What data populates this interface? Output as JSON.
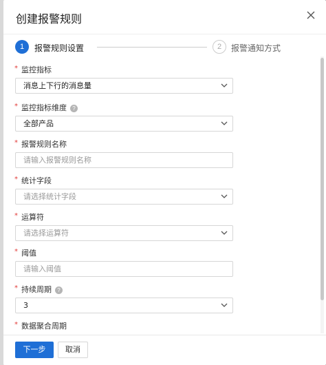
{
  "dialog": {
    "title": "创建报警规则"
  },
  "steps": [
    {
      "number": "1",
      "label": "报警规则设置",
      "active": true
    },
    {
      "number": "2",
      "label": "报警通知方式",
      "active": false
    }
  ],
  "fields": {
    "metric": {
      "label": "监控指标",
      "value": "消息上下行的消息量",
      "required": true
    },
    "dimension": {
      "label": "监控指标维度",
      "value": "全部产品",
      "required": true,
      "help_icon": "?"
    },
    "rule_name": {
      "label": "报警规则名称",
      "placeholder": "请输入报警规则名称",
      "required": true
    },
    "statistic": {
      "label": "统计字段",
      "placeholder": "请选择统计字段",
      "required": true
    },
    "operator": {
      "label": "运算符",
      "placeholder": "请选择运算符",
      "required": true
    },
    "threshold": {
      "label": "阈值",
      "placeholder": "请输入阈值",
      "required": true
    },
    "period": {
      "label": "持续周期",
      "value": "3",
      "required": true,
      "help_icon": "?"
    },
    "aggregation": {
      "label": "数据聚合周期",
      "required": true
    }
  },
  "footer": {
    "next_label": "下一步",
    "cancel_label": "取消"
  },
  "colors": {
    "primary": "#1f6fd6",
    "required_star": "#e23c39"
  },
  "icons": {
    "close": "close-icon",
    "chevron": "chevron-down-icon",
    "help": "question-circle-icon"
  }
}
